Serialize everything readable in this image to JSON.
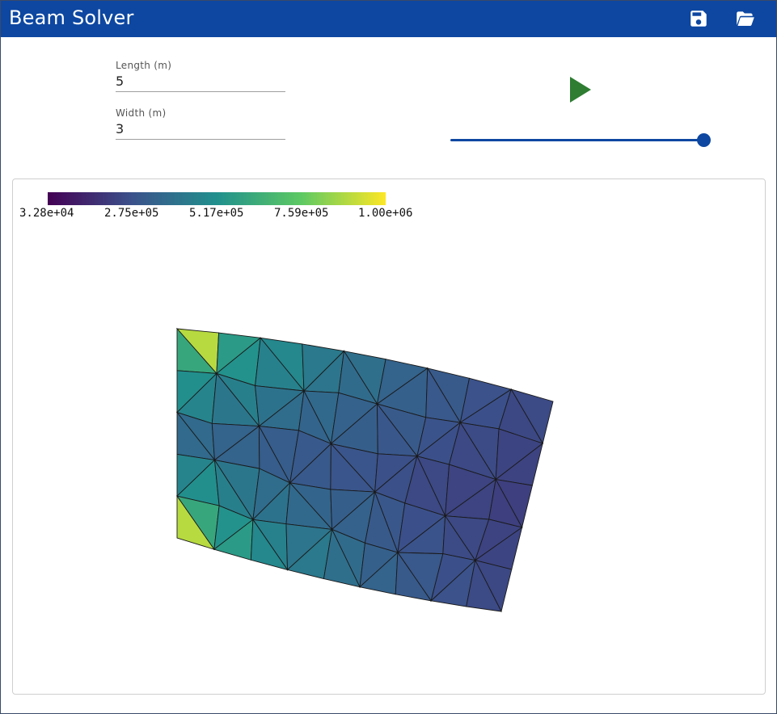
{
  "header": {
    "title": "Beam Solver",
    "save_icon": "save-icon",
    "open_icon": "folder-open-icon"
  },
  "form": {
    "length": {
      "label": "Length (m)",
      "value": "5"
    },
    "width": {
      "label": "Width (m)",
      "value": "3"
    }
  },
  "controls": {
    "play_icon": "play-icon",
    "play_color": "#2e7d32",
    "slider_value": 1.0
  },
  "colors": {
    "brand": "#0d47a1"
  },
  "viewer": {
    "colorbar": {
      "colormap": "viridis",
      "min": 32800,
      "max": 1000000,
      "tick_labels": [
        "3.28e+04",
        "2.75e+05",
        "5.17e+05",
        "7.59e+05",
        "1.00e+06"
      ]
    }
  }
}
